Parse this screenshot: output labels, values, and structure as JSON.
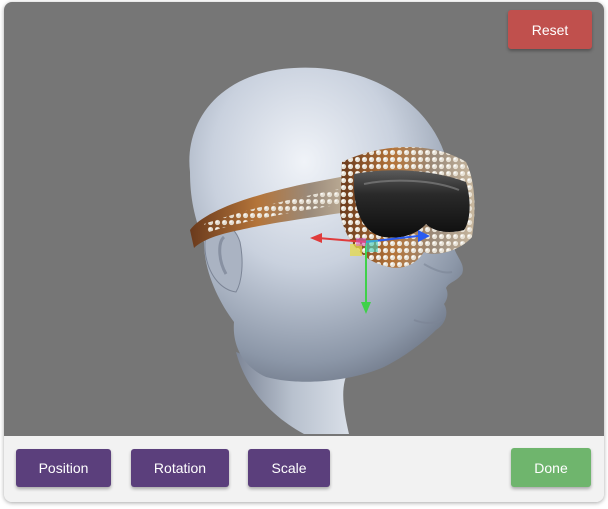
{
  "app": {
    "reset_label": "Reset"
  },
  "toolbar": {
    "position_label": "Position",
    "rotation_label": "Rotation",
    "scale_label": "Scale",
    "done_label": "Done"
  },
  "viewport": {
    "model": "mannequin head wearing studded sunglasses",
    "gizmo_axes": [
      "x-axis-red",
      "y-axis-green",
      "z-axis-blue"
    ]
  },
  "colors": {
    "viewport_bg": "#767676",
    "mode_button": "#5b3f7c",
    "done_button": "#6fb56d",
    "reset_button": "#c0504d",
    "toolbar_bg": "#f2f2f2"
  }
}
